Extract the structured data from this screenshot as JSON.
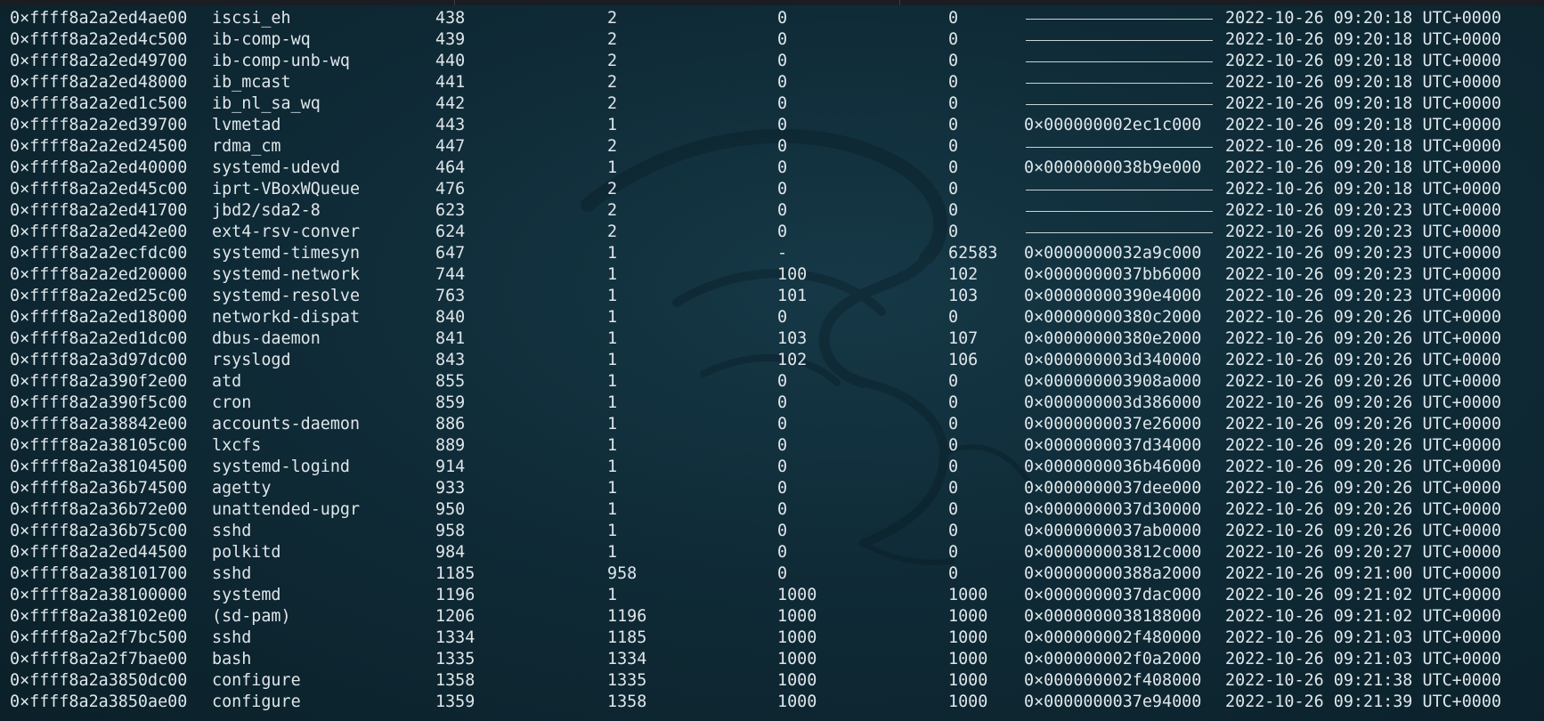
{
  "window": {
    "title": ""
  },
  "icons": {
    "watermark": "kali-dragon-icon"
  },
  "colors": {
    "background": "#0f2b37",
    "text": "#dfe6ea"
  },
  "rows": [
    {
      "offset": "0×ffff8a2a2ed4ae00",
      "name": "iscsi_eh",
      "pid": "438",
      "ppid": "2",
      "uid": "0",
      "gid": "0",
      "dtb": "",
      "time": "2022-10-26 09:20:18 UTC+0000"
    },
    {
      "offset": "0×ffff8a2a2ed4c500",
      "name": "ib-comp-wq",
      "pid": "439",
      "ppid": "2",
      "uid": "0",
      "gid": "0",
      "dtb": "",
      "time": "2022-10-26 09:20:18 UTC+0000"
    },
    {
      "offset": "0×ffff8a2a2ed49700",
      "name": "ib-comp-unb-wq",
      "pid": "440",
      "ppid": "2",
      "uid": "0",
      "gid": "0",
      "dtb": "",
      "time": "2022-10-26 09:20:18 UTC+0000"
    },
    {
      "offset": "0×ffff8a2a2ed48000",
      "name": "ib_mcast",
      "pid": "441",
      "ppid": "2",
      "uid": "0",
      "gid": "0",
      "dtb": "",
      "time": "2022-10-26 09:20:18 UTC+0000"
    },
    {
      "offset": "0×ffff8a2a2ed1c500",
      "name": "ib_nl_sa_wq",
      "pid": "442",
      "ppid": "2",
      "uid": "0",
      "gid": "0",
      "dtb": "",
      "time": "2022-10-26 09:20:18 UTC+0000"
    },
    {
      "offset": "0×ffff8a2a2ed39700",
      "name": "lvmetad",
      "pid": "443",
      "ppid": "1",
      "uid": "0",
      "gid": "0",
      "dtb": "0×000000002ec1c000",
      "time": "2022-10-26 09:20:18 UTC+0000"
    },
    {
      "offset": "0×ffff8a2a2ed24500",
      "name": "rdma_cm",
      "pid": "447",
      "ppid": "2",
      "uid": "0",
      "gid": "0",
      "dtb": "",
      "time": "2022-10-26 09:20:18 UTC+0000"
    },
    {
      "offset": "0×ffff8a2a2ed40000",
      "name": "systemd-udevd",
      "pid": "464",
      "ppid": "1",
      "uid": "0",
      "gid": "0",
      "dtb": "0×0000000038b9e000",
      "time": "2022-10-26 09:20:18 UTC+0000"
    },
    {
      "offset": "0×ffff8a2a2ed45c00",
      "name": "iprt-VBoxWQueue",
      "pid": "476",
      "ppid": "2",
      "uid": "0",
      "gid": "0",
      "dtb": "",
      "time": "2022-10-26 09:20:18 UTC+0000"
    },
    {
      "offset": "0×ffff8a2a2ed41700",
      "name": "jbd2/sda2-8",
      "pid": "623",
      "ppid": "2",
      "uid": "0",
      "gid": "0",
      "dtb": "",
      "time": "2022-10-26 09:20:23 UTC+0000"
    },
    {
      "offset": "0×ffff8a2a2ed42e00",
      "name": "ext4-rsv-conver",
      "pid": "624",
      "ppid": "2",
      "uid": "0",
      "gid": "0",
      "dtb": "",
      "time": "2022-10-26 09:20:23 UTC+0000"
    },
    {
      "offset": "0×ffff8a2a2ecfdc00",
      "name": "systemd-timesyn",
      "pid": "647",
      "ppid": "1",
      "uid": "-",
      "gid": "62583",
      "dtb": "0×0000000032a9c000",
      "time": "2022-10-26 09:20:23 UTC+0000"
    },
    {
      "offset": "0×ffff8a2a2ed20000",
      "name": "systemd-network",
      "pid": "744",
      "ppid": "1",
      "uid": "100",
      "gid": "102",
      "dtb": "0×0000000037bb6000",
      "time": "2022-10-26 09:20:23 UTC+0000"
    },
    {
      "offset": "0×ffff8a2a2ed25c00",
      "name": "systemd-resolve",
      "pid": "763",
      "ppid": "1",
      "uid": "101",
      "gid": "103",
      "dtb": "0×00000000390e4000",
      "time": "2022-10-26 09:20:23 UTC+0000"
    },
    {
      "offset": "0×ffff8a2a2ed18000",
      "name": "networkd-dispat",
      "pid": "840",
      "ppid": "1",
      "uid": "0",
      "gid": "0",
      "dtb": "0×00000000380c2000",
      "time": "2022-10-26 09:20:26 UTC+0000"
    },
    {
      "offset": "0×ffff8a2a2ed1dc00",
      "name": "dbus-daemon",
      "pid": "841",
      "ppid": "1",
      "uid": "103",
      "gid": "107",
      "dtb": "0×00000000380e2000",
      "time": "2022-10-26 09:20:26 UTC+0000"
    },
    {
      "offset": "0×ffff8a2a3d97dc00",
      "name": "rsyslogd",
      "pid": "843",
      "ppid": "1",
      "uid": "102",
      "gid": "106",
      "dtb": "0×000000003d340000",
      "time": "2022-10-26 09:20:26 UTC+0000"
    },
    {
      "offset": "0×ffff8a2a390f2e00",
      "name": "atd",
      "pid": "855",
      "ppid": "1",
      "uid": "0",
      "gid": "0",
      "dtb": "0×000000003908a000",
      "time": "2022-10-26 09:20:26 UTC+0000"
    },
    {
      "offset": "0×ffff8a2a390f5c00",
      "name": "cron",
      "pid": "859",
      "ppid": "1",
      "uid": "0",
      "gid": "0",
      "dtb": "0×000000003d386000",
      "time": "2022-10-26 09:20:26 UTC+0000"
    },
    {
      "offset": "0×ffff8a2a38842e00",
      "name": "accounts-daemon",
      "pid": "886",
      "ppid": "1",
      "uid": "0",
      "gid": "0",
      "dtb": "0×0000000037e26000",
      "time": "2022-10-26 09:20:26 UTC+0000"
    },
    {
      "offset": "0×ffff8a2a38105c00",
      "name": "lxcfs",
      "pid": "889",
      "ppid": "1",
      "uid": "0",
      "gid": "0",
      "dtb": "0×0000000037d34000",
      "time": "2022-10-26 09:20:26 UTC+0000"
    },
    {
      "offset": "0×ffff8a2a38104500",
      "name": "systemd-logind",
      "pid": "914",
      "ppid": "1",
      "uid": "0",
      "gid": "0",
      "dtb": "0×0000000036b46000",
      "time": "2022-10-26 09:20:26 UTC+0000"
    },
    {
      "offset": "0×ffff8a2a36b74500",
      "name": "agetty",
      "pid": "933",
      "ppid": "1",
      "uid": "0",
      "gid": "0",
      "dtb": "0×0000000037dee000",
      "time": "2022-10-26 09:20:26 UTC+0000"
    },
    {
      "offset": "0×ffff8a2a36b72e00",
      "name": "unattended-upgr",
      "pid": "950",
      "ppid": "1",
      "uid": "0",
      "gid": "0",
      "dtb": "0×0000000037d30000",
      "time": "2022-10-26 09:20:26 UTC+0000"
    },
    {
      "offset": "0×ffff8a2a36b75c00",
      "name": "sshd",
      "pid": "958",
      "ppid": "1",
      "uid": "0",
      "gid": "0",
      "dtb": "0×0000000037ab0000",
      "time": "2022-10-26 09:20:26 UTC+0000"
    },
    {
      "offset": "0×ffff8a2a2ed44500",
      "name": "polkitd",
      "pid": "984",
      "ppid": "1",
      "uid": "0",
      "gid": "0",
      "dtb": "0×000000003812c000",
      "time": "2022-10-26 09:20:27 UTC+0000"
    },
    {
      "offset": "0×ffff8a2a38101700",
      "name": "sshd",
      "pid": "1185",
      "ppid": "958",
      "uid": "0",
      "gid": "0",
      "dtb": "0×00000000388a2000",
      "time": "2022-10-26 09:21:00 UTC+0000"
    },
    {
      "offset": "0×ffff8a2a38100000",
      "name": "systemd",
      "pid": "1196",
      "ppid": "1",
      "uid": "1000",
      "gid": "1000",
      "dtb": "0×0000000037dac000",
      "time": "2022-10-26 09:21:02 UTC+0000"
    },
    {
      "offset": "0×ffff8a2a38102e00",
      "name": "(sd-pam)",
      "pid": "1206",
      "ppid": "1196",
      "uid": "1000",
      "gid": "1000",
      "dtb": "0×0000000038188000",
      "time": "2022-10-26 09:21:02 UTC+0000"
    },
    {
      "offset": "0×ffff8a2a2f7bc500",
      "name": "sshd",
      "pid": "1334",
      "ppid": "1185",
      "uid": "1000",
      "gid": "1000",
      "dtb": "0×000000002f480000",
      "time": "2022-10-26 09:21:03 UTC+0000"
    },
    {
      "offset": "0×ffff8a2a2f7bae00",
      "name": "bash",
      "pid": "1335",
      "ppid": "1334",
      "uid": "1000",
      "gid": "1000",
      "dtb": "0×000000002f0a2000",
      "time": "2022-10-26 09:21:03 UTC+0000"
    },
    {
      "offset": "0×ffff8a2a3850dc00",
      "name": "configure",
      "pid": "1358",
      "ppid": "1335",
      "uid": "1000",
      "gid": "1000",
      "dtb": "0×000000002f408000",
      "time": "2022-10-26 09:21:38 UTC+0000"
    },
    {
      "offset": "0×ffff8a2a3850ae00",
      "name": "configure",
      "pid": "1359",
      "ppid": "1358",
      "uid": "1000",
      "gid": "1000",
      "dtb": "0×0000000037e94000",
      "time": "2022-10-26 09:21:39 UTC+0000"
    }
  ]
}
